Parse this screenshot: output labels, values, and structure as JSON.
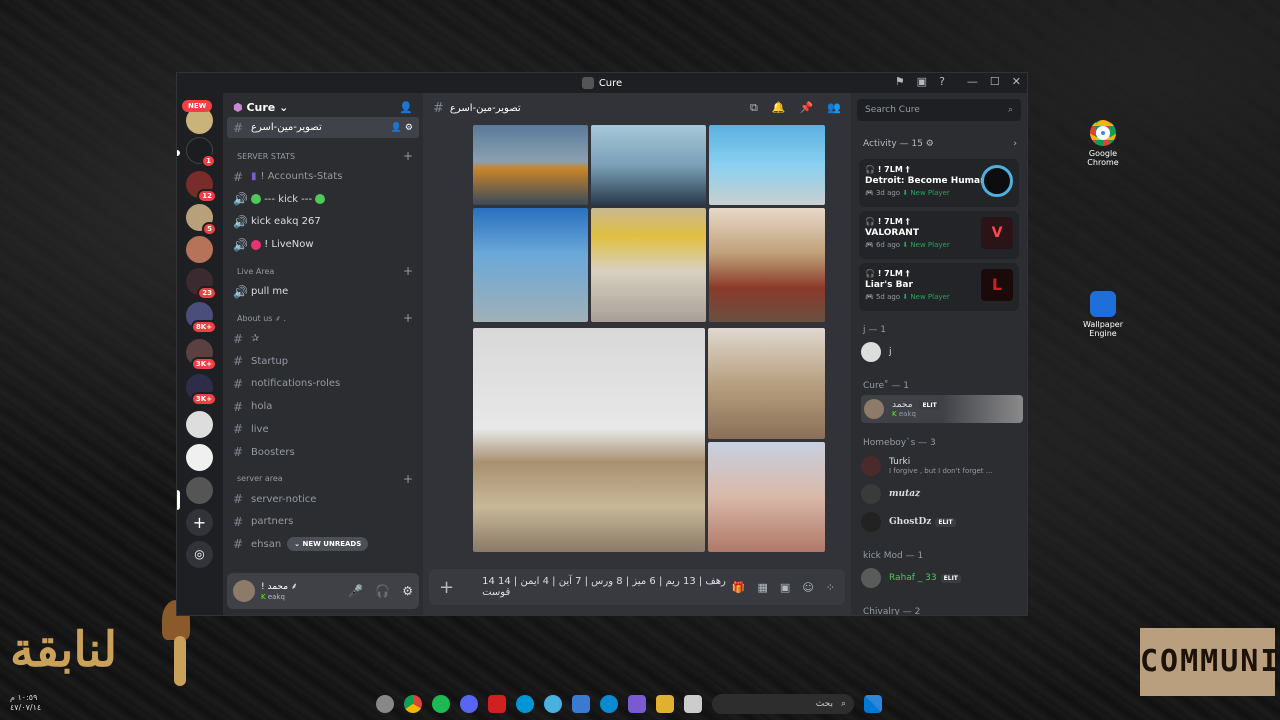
{
  "window": {
    "title": "Cure"
  },
  "servers": [
    {
      "badge": "NEW"
    },
    {
      "badge": "1"
    },
    {
      "badge": "12"
    },
    {
      "badge": "5"
    },
    {
      "badge": ""
    },
    {
      "badge": "23"
    },
    {
      "badge": "8K+"
    },
    {
      "badge": "3K+"
    },
    {
      "badge": "3K+"
    },
    {
      "badge": ""
    },
    {
      "badge": ""
    },
    {
      "badge": ""
    }
  ],
  "sidebar": {
    "server_name": "Cure",
    "active_channel": "تصوير-مين-اسرع",
    "categories": {
      "stats": "SERVER STATS",
      "live": "Live Area",
      "about": "About us ⸙ .",
      "area": "server area"
    },
    "channels": {
      "accounts": "! Accounts-Stats",
      "kick": "--- kick ---",
      "kick_eakq": "kick eakq 267",
      "livenow": "! LiveNow",
      "pullme": "pull me",
      "star": "✰",
      "startup": "Startup",
      "notif": "notifications-roles",
      "hola": "hola",
      "live": "live",
      "boosters": "Boosters",
      "notice": "server-notice",
      "partners": "partners",
      "ehsan": "ehsan"
    },
    "new_unreads": "NEW UNREADS",
    "user": {
      "name": "! محمد ⸙",
      "sub": "eakq"
    }
  },
  "main": {
    "channel": "تصوير-مين-اسرع",
    "composer_text": "14 رهف | 13 ريم | 6 ميز | 8 ورس | 7 آين | 4 ايمن | 14 قوست"
  },
  "members": {
    "search_placeholder": "Search Cure",
    "activity_title": "Activity — 15 ⚙",
    "activities": [
      {
        "user": "🎧 ! 7LM †",
        "game": "Detroit: Become Human",
        "time": "🎮 3d ago",
        "status": "⬇ New Player",
        "color": "#0d0d0f"
      },
      {
        "user": "🎧 ! 7LM †",
        "game": "VALORANT",
        "time": "🎮 6d ago",
        "status": "⬇ New Player",
        "color": "#2a1418"
      },
      {
        "user": "🎧 ! 7LM †",
        "game": "Liar's Bar",
        "time": "🎮 5d ago",
        "status": "⬇ New Player",
        "color": "#1a0a0a"
      }
    ],
    "groups": {
      "j": "j — 1",
      "cure": "Cure˚ — 1",
      "homeboys": "Homeboy`s — 3",
      "kickmod": "kick Mod — 1",
      "chivalry": "Chivalry — 2"
    },
    "list": {
      "j": "j",
      "cure_user": "محمد",
      "cure_sub": "eakq",
      "turki": "Turki",
      "turki_sub": "I forgive , but I don't forget ...",
      "mutaz": "mutaz",
      "ghost": "GhostDz",
      "rahaf": "Rahaf _ 33",
      "elit": "ELIT"
    }
  },
  "desktop": {
    "chrome": "Google Chrome",
    "wallpaper": "Wallpaper Engine",
    "community": "COMMUNITY",
    "clock_time": "١٠:٥٩ م",
    "clock_date": "٤٧/٠٧/١٤",
    "search_label": "بحث"
  }
}
